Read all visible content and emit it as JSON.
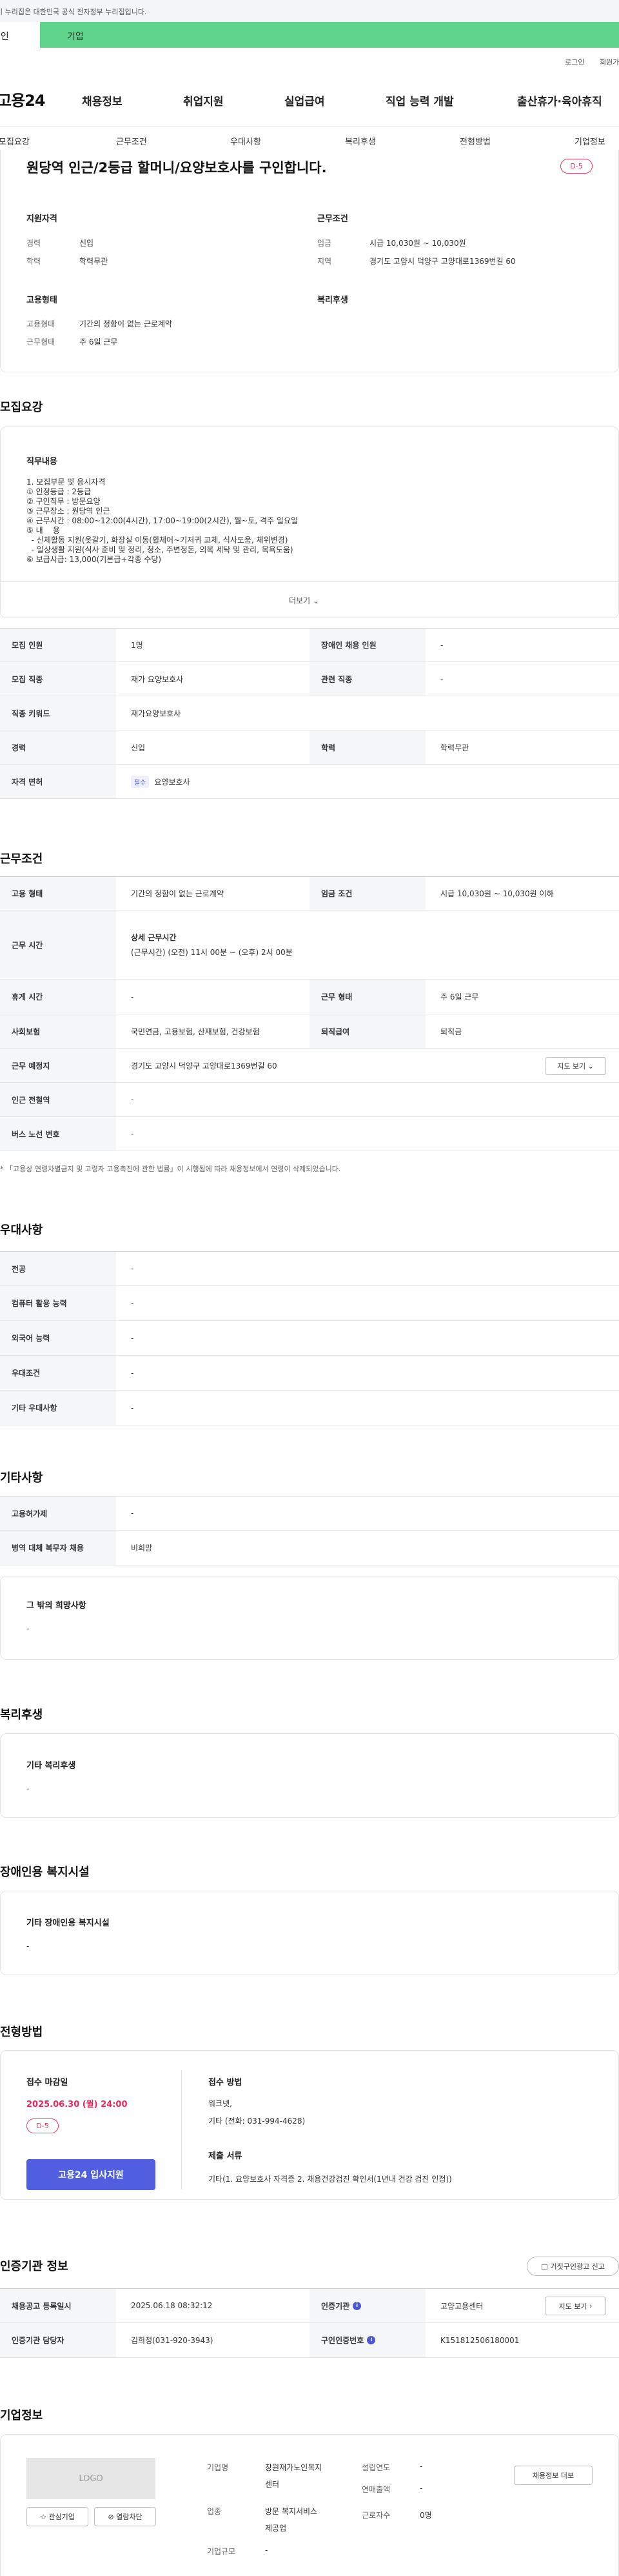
{
  "gov_bar": {
    "text": "이 누리집은 대한민국 공식 전자정부 누리집입니다."
  },
  "tabs": {
    "person": "개인",
    "company": "기업"
  },
  "util": {
    "login": "로그인",
    "join": "회원가입"
  },
  "logo": "고용24",
  "gnb": [
    "채용정보",
    "취업지원",
    "실업급여",
    "직업 능력 개발",
    "출산휴가·육아휴직"
  ],
  "snb": [
    "모집요강",
    "근무조건",
    "우대사항",
    "복리후생",
    "전형방법",
    "기업정보"
  ],
  "summary": {
    "title": "원당역 인근/2등급 할머니/요양보호사를 구인합니다.",
    "dday": "D-5",
    "qual_h": "지원자격",
    "career_l": "경력",
    "career_v": "신입",
    "edu_l": "학력",
    "edu_v": "학력무관",
    "cond_h": "근무조건",
    "wage_l": "임금",
    "wage_v": "시급 10,030원 ~ 10,030원",
    "region_l": "지역",
    "region_v": "경기도 고양시 덕양구 고양대로1369번길 60",
    "emp_h": "고용형태",
    "emptype_l": "고용형태",
    "emptype_v": "기간의 정함이 없는 근로계약",
    "workform_l": "근무형태",
    "workform_v": "주 6일 근무",
    "welfare_h": "복리후생"
  },
  "recruit": {
    "title": "모집요강",
    "job_h": "직무내용",
    "job_lines": [
      "1. 모집부문 및 응시자격",
      "① 인정등급 : 2등급",
      "② 구인직무 : 방문요양",
      "③ 근무장소 : 원당역 인근",
      "④ 근무시간 : 08:00~12:00(4시간), 17:00~19:00(2시간), 월~토, 격주 일요일",
      "⑤ 내    용",
      "  - 신체활동 지원(옷갈기, 화장실 이동(휠체어~기저귀 교체, 식사도움, 체위변경)",
      "  - 일상생활 지원(식사 준비 및 정리, 청소, 주변정돈, 의복 세탁 및 관리, 목욕도움)",
      "⑥ 보급시급: 13,000(기본급+각종 수당)"
    ],
    "more": "더보기",
    "rows": [
      {
        "l1": "모집 인원",
        "v1": "1명",
        "l2": "장애인 채용 인원",
        "v2": "-"
      },
      {
        "l1": "모집 직종",
        "v1": "재가 요양보호사",
        "l2": "관련 직종",
        "v2": "-"
      },
      {
        "l1": "직종 키워드",
        "v1": "재가요양보호사"
      },
      {
        "l1": "경력",
        "v1": "신입",
        "l2": "학력",
        "v2": "학력무관"
      },
      {
        "l1": "자격 면허",
        "chip": "필수",
        "v1": "요양보호사"
      }
    ]
  },
  "work": {
    "title": "근무조건",
    "emp_l": "고용 형태",
    "emp_v": "기간의 정함이 없는 근로계약",
    "wage_l": "임금 조건",
    "wage_v": "시급 10,030원 ~ 10,030원 이하",
    "time_l": "근무 시간",
    "time_h": "상세 근무시간",
    "time_v": "(근무시간) (오전) 11시 00분 ~ (오후) 2시 00분",
    "rest_l": "휴게 시간",
    "rest_v": "-",
    "form_l": "근무 형태",
    "form_v": "주 6일 근무",
    "ins_l": "사회보험",
    "ins_v": "국민연금, 고용보험, 산재보험, 건강보험",
    "retire_l": "퇴직급여",
    "retire_v": "퇴직금",
    "place_l": "근무 예정지",
    "place_v": "경기도 고양시 덕양구 고양대로1369번길 60",
    "map_btn": "지도 보기",
    "subway_l": "인근 전철역",
    "subway_v": "-",
    "bus_l": "버스 노선 번호",
    "bus_v": "-",
    "note": "* 「고용상 연령차별금지 및 고령자 고용촉진에 관한 법률」이 시행됨에 따라 채용정보에서 연령이 삭제되었습니다."
  },
  "pref": {
    "title": "우대사항",
    "rows": [
      {
        "l": "전공",
        "v": "-"
      },
      {
        "l": "컴퓨터 활용 능력",
        "v": "-"
      },
      {
        "l": "외국어 능력",
        "v": "-"
      },
      {
        "l": "우대조건",
        "v": "-"
      },
      {
        "l": "기타 우대사항",
        "v": "-"
      }
    ]
  },
  "etc": {
    "title": "기타사항",
    "rows": [
      {
        "l": "고용허가제",
        "v": "-"
      },
      {
        "l": "병역 대체 복무자 채용",
        "v": "비희망"
      }
    ],
    "other_h": "그 밖의 희망사항",
    "other_v": "-"
  },
  "welfare": {
    "title": "복리후생",
    "h": "기타 복리후생",
    "v": "-"
  },
  "disab": {
    "title": "장애인용 복지시설",
    "h": "기타 장애인용 복지시설",
    "v": "-"
  },
  "select": {
    "title": "전형방법",
    "deadline_h": "접수 마감일",
    "deadline_v": "2025.06.30 (월) 24:00",
    "dday": "D-5",
    "apply": "고용24 입사지원",
    "method_h": "접수 방법",
    "method_v1": "워크넷,",
    "method_v2": "기타 (전화: 031-994-4628)",
    "docs_h": "제출 서류",
    "docs_v": "기타(1. 요양보호사 자격증 2. 채용건강검진 확인서(1년내 건강 검진 인정))"
  },
  "agency": {
    "title": "인증기관 정보",
    "report_btn": "거짓구인광고 신고",
    "reg_l": "채용공고 등록일시",
    "reg_v": "2025.06.18 08:32:12",
    "org_l": "인증기관",
    "org_v": "고양고용센터",
    "map_btn": "지도 보기",
    "mgr_l": "인증기관 담당자",
    "mgr_v": "김희정(031-920-3943)",
    "no_l": "구인인증번호",
    "no_v": "K151812506180001"
  },
  "company": {
    "title": "기업정보",
    "logo": "LOGO",
    "fav": "관심기업",
    "block": "열람차단",
    "name_l": "기업명",
    "name_v1": "창원재가노인복지",
    "name_v2": "센터",
    "est_l": "설립연도",
    "est_v": "-",
    "sales_l": "연매출액",
    "sales_v": "-",
    "ind_l": "업종",
    "ind_v1": "방문 복지서비스",
    "ind_v2": "제공업",
    "emp_l": "근로자수",
    "emp_v": "0명",
    "size_l": "기업규모",
    "size_v": "-",
    "info_btn": "채용정보 더보"
  }
}
